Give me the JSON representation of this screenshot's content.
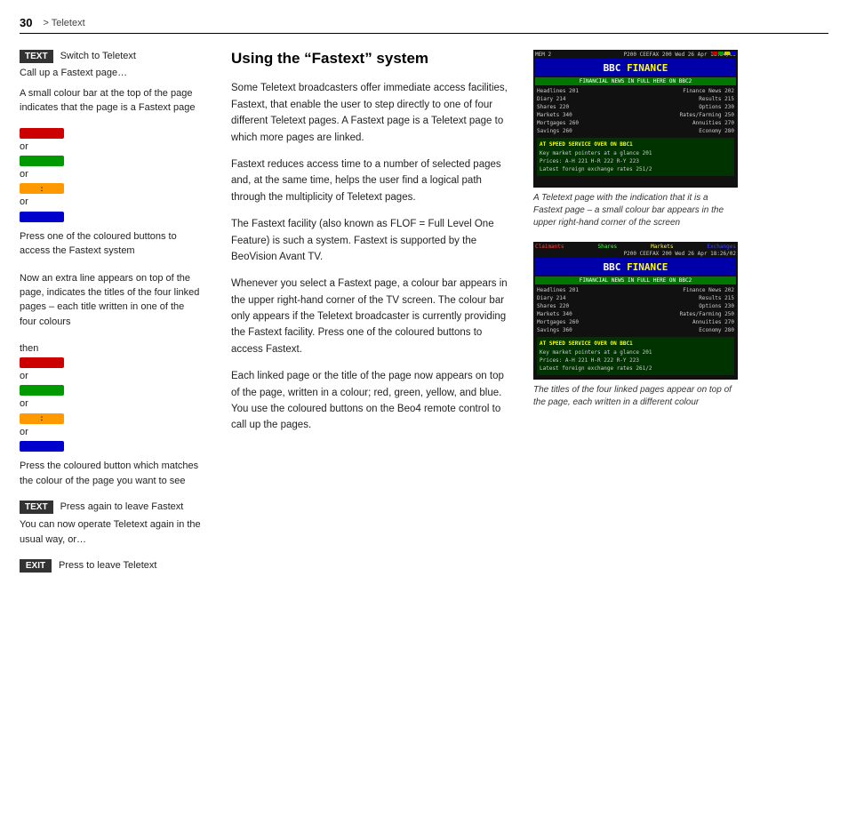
{
  "header": {
    "page_number": "30",
    "breadcrumb": "> Teletext"
  },
  "left_column": {
    "section1": {
      "btn_label": "TEXT",
      "text1": "Switch to Teletext",
      "text2": "Call up a Fastext page…",
      "text3": "A small colour bar at the top of the page indicates that the page is a Fastext page"
    },
    "section2": {
      "intro": "Press one of the coloured buttons to access the Fastext system",
      "or_label": "or",
      "then_text": "Now an extra line appears on top of the page, indicates the titles of the four linked pages – each title written in one of the four colours"
    },
    "section3": {
      "then_label": "then",
      "text": "Press the coloured button which matches the colour of the page you want to see"
    },
    "section4": {
      "btn_label": "TEXT",
      "text1": "Press again to leave Fastext",
      "text2": "You can now operate Teletext again in the usual way, or…"
    },
    "section5": {
      "btn_label": "EXIT",
      "text": "Press to leave Teletext"
    }
  },
  "center_column": {
    "title": "Using the “Fastext” system",
    "paragraphs": [
      "Some Teletext broadcasters offer immediate access facilities, Fastext, that enable the user to step directly to one of four different Teletext pages. A Fastext page is a Teletext page to which more pages are linked.",
      "Fastext reduces access time to a number of selected pages and, at the same time, helps the user find a logical path through the multiplicity of Teletext pages.",
      "The Fastext facility (also known as FLOF = Full Level One Feature) is such a system. Fastext is supported by the BeoVision Avant TV.",
      "Whenever you select a Fastext page, a colour bar appears in the upper right-hand corner of the TV screen. The colour bar only appears if the Teletext broadcaster is currently providing the Fastext facility. Press one of the coloured buttons to access Fastext.",
      "Each linked page or the title of the page now appears on top of the page, written in a colour; red, green, yellow, and blue. You use the coloured buttons on the Beo4 remote control to call up the pages."
    ]
  },
  "right_column": {
    "image1": {
      "caption": "A Teletext page with the indication that it is a Fastext page – a small colour bar appears in the upper right-hand corner of the screen"
    },
    "image2": {
      "caption": "The titles of the four linked pages appear on top of the page, each written in a different colour"
    }
  }
}
